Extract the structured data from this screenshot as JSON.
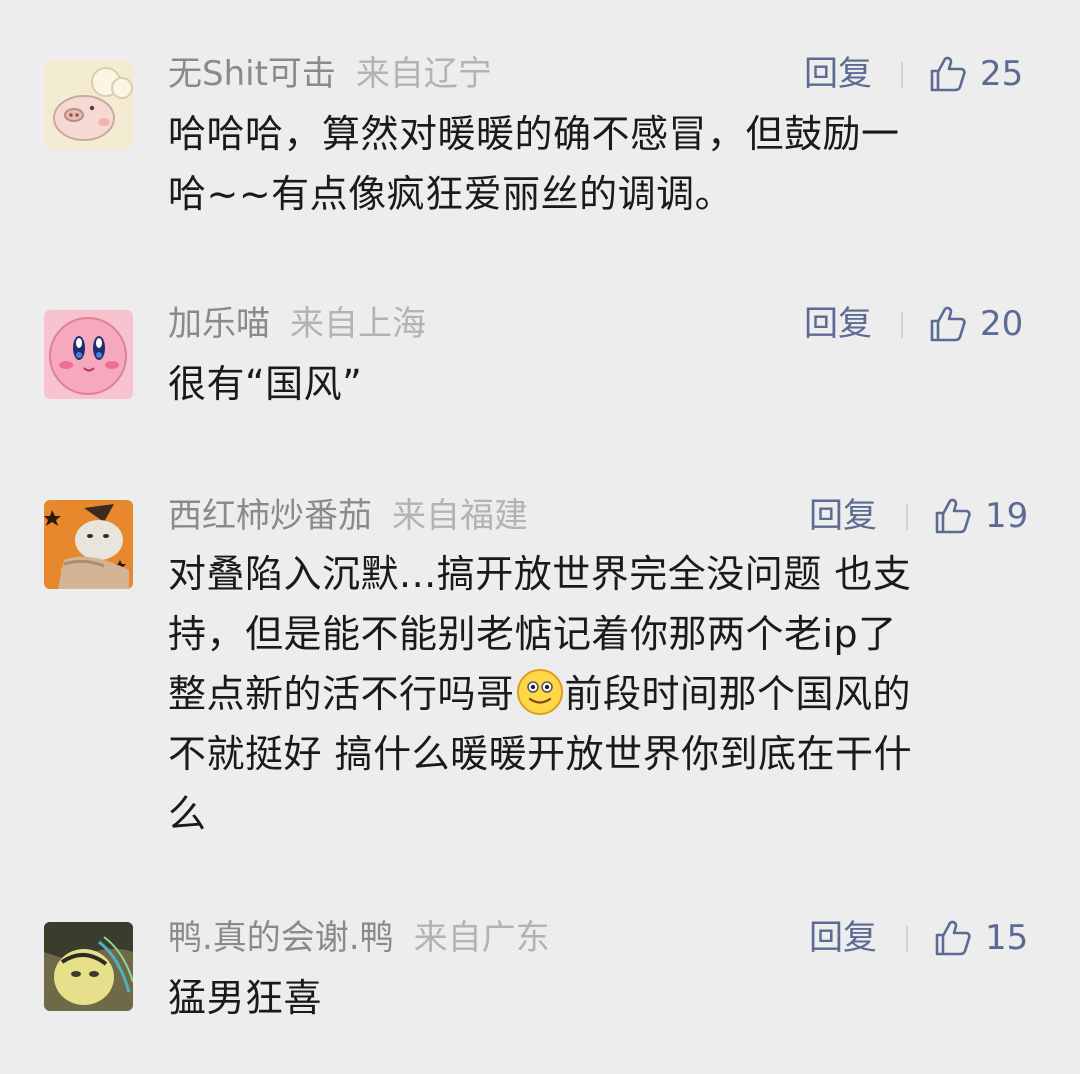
{
  "comments": [
    {
      "username": "无Shit可击",
      "location": "来自辽宁",
      "reply_label": "回复",
      "likes": "25",
      "lines": [
        "哈哈哈，算然对暖暖的确不感冒，但鼓励一",
        "哈~~有点像疯狂爱丽丝的调调。"
      ],
      "avatar_icon": "pig-avatar"
    },
    {
      "username": "加乐喵",
      "location": "来自上海",
      "reply_label": "回复",
      "likes": "20",
      "lines": [
        "很有“国风”"
      ],
      "avatar_icon": "kirby-avatar"
    },
    {
      "username": "西红柿炒番茄",
      "location": "来自福建",
      "reply_label": "回复",
      "likes": "19",
      "lines": [
        "对叠陷入沉默...搞开放世界完全没问题 也支",
        "持，但是能不能别老惦记着你那两个老ip了",
        "整点新的活不行吗哥",
        "前段时间那个国风的",
        "不就挺好 搞什么暖暖开放世界你到底在干什",
        "么"
      ],
      "avatar_icon": "cat-avatar",
      "inline_emoji": "smile-emoji"
    },
    {
      "username": "鸭.真的会谢.鸭",
      "location": "来自广东",
      "reply_label": "回复",
      "likes": "15",
      "lines": [
        "猛男狂喜"
      ],
      "avatar_icon": "anime-avatar"
    }
  ],
  "colors": {
    "background": "#ededed",
    "username": "#8a8a8a",
    "location": "#b3b3b3",
    "accent": "#5b6b93",
    "text": "#1a1a1a"
  }
}
